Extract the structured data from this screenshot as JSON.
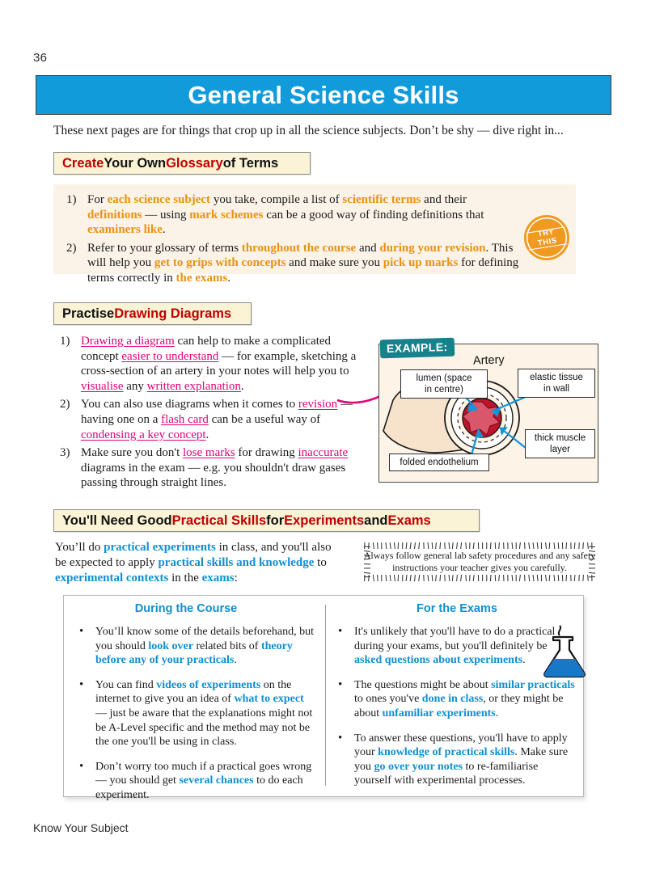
{
  "page_number": "36",
  "title": "General Science Skills",
  "intro": "These next pages are for things that crop up in all the science subjects.  Don’t be shy — dive right in...",
  "footer": "Know Your Subject",
  "colors": {
    "banner_blue": "#129BDB",
    "heading_red": "#C00000",
    "accent_orange": "#E89212",
    "accent_magenta": "#E2007A",
    "accent_blue": "#108FD0",
    "example_teal": "#17828C",
    "cream_panel": "#FCF3E8",
    "heading_box": "#FBF3D5"
  },
  "section1": {
    "heading_parts": [
      {
        "t": "Create",
        "c": "red"
      },
      {
        "t": " Your Own ",
        "c": "black"
      },
      {
        "t": "Glossary",
        "c": "red"
      },
      {
        "t": " of Terms",
        "c": "black"
      }
    ],
    "items": [
      {
        "num": "1)",
        "parts": [
          {
            "t": "For ",
            "s": "n"
          },
          {
            "t": "each science subject",
            "s": "o"
          },
          {
            "t": " you take, compile a list of ",
            "s": "n"
          },
          {
            "t": "scientific terms",
            "s": "o"
          },
          {
            "t": " and their ",
            "s": "n"
          },
          {
            "t": "definitions",
            "s": "o"
          },
          {
            "t": " — using ",
            "s": "n"
          },
          {
            "t": "mark schemes",
            "s": "o"
          },
          {
            "t": " can be a good way of finding definitions that ",
            "s": "n"
          },
          {
            "t": "examiners like",
            "s": "o"
          },
          {
            "t": ".",
            "s": "n"
          }
        ]
      },
      {
        "num": "2)",
        "parts": [
          {
            "t": "Refer to your glossary of terms ",
            "s": "n"
          },
          {
            "t": "throughout the course",
            "s": "o"
          },
          {
            "t": " and ",
            "s": "n"
          },
          {
            "t": "during your revision",
            "s": "o"
          },
          {
            "t": ". This will help you ",
            "s": "n"
          },
          {
            "t": "get to grips with concepts",
            "s": "o"
          },
          {
            "t": " and make sure you ",
            "s": "n"
          },
          {
            "t": "pick up marks",
            "s": "o"
          },
          {
            "t": " for defining terms correctly in ",
            "s": "n"
          },
          {
            "t": "the exams",
            "s": "o"
          },
          {
            "t": ".",
            "s": "n"
          }
        ]
      }
    ],
    "stamp": {
      "line1": "TRY",
      "line2": "THIS"
    }
  },
  "section2": {
    "heading_parts": [
      {
        "t": "Practise ",
        "c": "black"
      },
      {
        "t": "Drawing Diagrams",
        "c": "red"
      }
    ],
    "items": [
      {
        "num": "1)",
        "parts": [
          {
            "t": "Drawing a diagram",
            "s": "m"
          },
          {
            "t": " can help to make a complicated concept ",
            "s": "n"
          },
          {
            "t": "easier to understand",
            "s": "m"
          },
          {
            "t": " — for example, sketching a cross-section of an artery in your notes will help you to ",
            "s": "n"
          },
          {
            "t": "visualise",
            "s": "m"
          },
          {
            "t": " any ",
            "s": "n"
          },
          {
            "t": "written explanation",
            "s": "m"
          },
          {
            "t": ".",
            "s": "n"
          }
        ]
      },
      {
        "num": "2)",
        "parts": [
          {
            "t": "You can also use diagrams when it comes to ",
            "s": "n"
          },
          {
            "t": "revision",
            "s": "m"
          },
          {
            "t": " — having one on a ",
            "s": "n"
          },
          {
            "t": "flash card",
            "s": "m"
          },
          {
            "t": " can be a useful way of ",
            "s": "n"
          },
          {
            "t": "condensing a key concept",
            "s": "m"
          },
          {
            "t": ".",
            "s": "n"
          }
        ]
      },
      {
        "num": "3)",
        "parts": [
          {
            "t": "Make sure you don't ",
            "s": "n"
          },
          {
            "t": "lose marks",
            "s": "m"
          },
          {
            "t": " for drawing ",
            "s": "n"
          },
          {
            "t": "inaccurate",
            "s": "m"
          },
          {
            "t": " diagrams in the exam — e.g. you shouldn't draw gases passing through straight lines.",
            "s": "n"
          }
        ]
      }
    ],
    "example": {
      "tab_label": "EXAMPLE:",
      "diagram_title": "Artery",
      "labels": {
        "lumen": "lumen (space\nin centre)",
        "elastic": "elastic tissue\nin wall",
        "muscle": "thick muscle\nlayer",
        "endothelium": "folded endothelium"
      }
    }
  },
  "section3": {
    "heading_parts": [
      {
        "t": "You'll Need Good ",
        "c": "black"
      },
      {
        "t": "Practical Skills",
        "c": "red"
      },
      {
        "t": " for ",
        "c": "black"
      },
      {
        "t": "Experiments",
        "c": "red"
      },
      {
        "t": " and ",
        "c": "black"
      },
      {
        "t": "Exams",
        "c": "red"
      }
    ],
    "intro_parts": [
      {
        "t": "You’ll do ",
        "s": "n"
      },
      {
        "t": "practical experiments",
        "s": "b"
      },
      {
        "t": " in class, and you'll also be expected to apply ",
        "s": "n"
      },
      {
        "t": "practical skills and knowledge",
        "s": "b"
      },
      {
        "t": " to ",
        "s": "n"
      },
      {
        "t": "experimental contexts",
        "s": "b"
      },
      {
        "t": " in the ",
        "s": "n"
      },
      {
        "t": "exams",
        "s": "b"
      },
      {
        "t": ":",
        "s": "n"
      }
    ],
    "safety_note": "Always follow general lab safety procedures and any safety instructions your teacher gives you carefully.",
    "columns": [
      {
        "title": "During the Course",
        "bullets": [
          [
            {
              "t": "You’ll know some of the details beforehand, but you should ",
              "s": "n"
            },
            {
              "t": "look over",
              "s": "b"
            },
            {
              "t": " related bits of ",
              "s": "n"
            },
            {
              "t": "theory before any of your practicals",
              "s": "b"
            },
            {
              "t": ".",
              "s": "n"
            }
          ],
          [
            {
              "t": "You can find ",
              "s": "n"
            },
            {
              "t": "videos of experiments",
              "s": "b"
            },
            {
              "t": " on the internet to give you an idea of ",
              "s": "n"
            },
            {
              "t": "what to expect",
              "s": "b"
            },
            {
              "t": " — just be aware that the explanations might not be A-Level specific and the method may not be the one you'll be using in class.",
              "s": "n"
            }
          ],
          [
            {
              "t": "Don’t worry too much if a practical goes wrong — you should get ",
              "s": "n"
            },
            {
              "t": "several chances",
              "s": "b"
            },
            {
              "t": " to do each experiment.",
              "s": "n"
            }
          ]
        ]
      },
      {
        "title": "For the Exams",
        "bullets": [
          [
            {
              "t": "It's unlikely that you'll have to do a practical during your exams, but you'll definitely be ",
              "s": "n"
            },
            {
              "t": "asked questions about experiments",
              "s": "b"
            },
            {
              "t": ".",
              "s": "n"
            }
          ],
          [
            {
              "t": "The questions might be about ",
              "s": "n"
            },
            {
              "t": "similar practicals",
              "s": "b"
            },
            {
              "t": " to ones you've ",
              "s": "n"
            },
            {
              "t": "done in class",
              "s": "b"
            },
            {
              "t": ", or they might be about ",
              "s": "n"
            },
            {
              "t": "unfamiliar experiments",
              "s": "b"
            },
            {
              "t": ".",
              "s": "n"
            }
          ],
          [
            {
              "t": "To answer these questions, you'll have to apply your ",
              "s": "n"
            },
            {
              "t": "knowledge of practical skills",
              "s": "b"
            },
            {
              "t": ".  Make sure you ",
              "s": "n"
            },
            {
              "t": "go over your notes",
              "s": "b"
            },
            {
              "t": " to re-familiarise yourself with experimental processes.",
              "s": "n"
            }
          ]
        ]
      }
    ],
    "flask_icon": "conical-flask-icon"
  }
}
